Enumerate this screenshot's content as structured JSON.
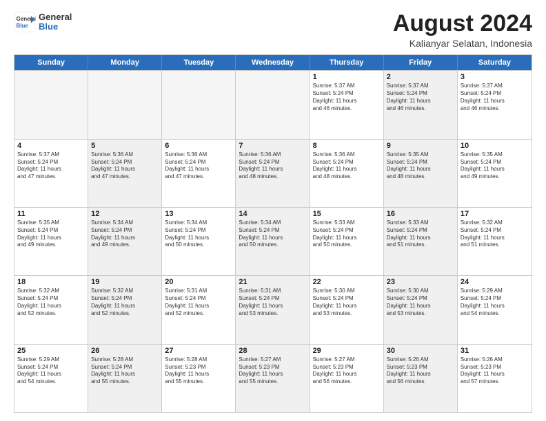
{
  "logo": {
    "line1": "General",
    "line2": "Blue"
  },
  "title": "August 2024",
  "subtitle": "Kalianyar Selatan, Indonesia",
  "headers": [
    "Sunday",
    "Monday",
    "Tuesday",
    "Wednesday",
    "Thursday",
    "Friday",
    "Saturday"
  ],
  "rows": [
    [
      {
        "day": "",
        "info": "",
        "empty": true
      },
      {
        "day": "",
        "info": "",
        "empty": true
      },
      {
        "day": "",
        "info": "",
        "empty": true
      },
      {
        "day": "",
        "info": "",
        "empty": true
      },
      {
        "day": "1",
        "info": "Sunrise: 5:37 AM\nSunset: 5:24 PM\nDaylight: 11 hours\nand 46 minutes.",
        "empty": false,
        "shaded": false
      },
      {
        "day": "2",
        "info": "Sunrise: 5:37 AM\nSunset: 5:24 PM\nDaylight: 11 hours\nand 46 minutes.",
        "empty": false,
        "shaded": true
      },
      {
        "day": "3",
        "info": "Sunrise: 5:37 AM\nSunset: 5:24 PM\nDaylight: 11 hours\nand 46 minutes.",
        "empty": false,
        "shaded": false
      }
    ],
    [
      {
        "day": "4",
        "info": "Sunrise: 5:37 AM\nSunset: 5:24 PM\nDaylight: 11 hours\nand 47 minutes.",
        "empty": false,
        "shaded": false
      },
      {
        "day": "5",
        "info": "Sunrise: 5:36 AM\nSunset: 5:24 PM\nDaylight: 11 hours\nand 47 minutes.",
        "empty": false,
        "shaded": true
      },
      {
        "day": "6",
        "info": "Sunrise: 5:36 AM\nSunset: 5:24 PM\nDaylight: 11 hours\nand 47 minutes.",
        "empty": false,
        "shaded": false
      },
      {
        "day": "7",
        "info": "Sunrise: 5:36 AM\nSunset: 5:24 PM\nDaylight: 11 hours\nand 48 minutes.",
        "empty": false,
        "shaded": true
      },
      {
        "day": "8",
        "info": "Sunrise: 5:36 AM\nSunset: 5:24 PM\nDaylight: 11 hours\nand 48 minutes.",
        "empty": false,
        "shaded": false
      },
      {
        "day": "9",
        "info": "Sunrise: 5:35 AM\nSunset: 5:24 PM\nDaylight: 11 hours\nand 48 minutes.",
        "empty": false,
        "shaded": true
      },
      {
        "day": "10",
        "info": "Sunrise: 5:35 AM\nSunset: 5:24 PM\nDaylight: 11 hours\nand 49 minutes.",
        "empty": false,
        "shaded": false
      }
    ],
    [
      {
        "day": "11",
        "info": "Sunrise: 5:35 AM\nSunset: 5:24 PM\nDaylight: 11 hours\nand 49 minutes.",
        "empty": false,
        "shaded": false
      },
      {
        "day": "12",
        "info": "Sunrise: 5:34 AM\nSunset: 5:24 PM\nDaylight: 11 hours\nand 49 minutes.",
        "empty": false,
        "shaded": true
      },
      {
        "day": "13",
        "info": "Sunrise: 5:34 AM\nSunset: 5:24 PM\nDaylight: 11 hours\nand 50 minutes.",
        "empty": false,
        "shaded": false
      },
      {
        "day": "14",
        "info": "Sunrise: 5:34 AM\nSunset: 5:24 PM\nDaylight: 11 hours\nand 50 minutes.",
        "empty": false,
        "shaded": true
      },
      {
        "day": "15",
        "info": "Sunrise: 5:33 AM\nSunset: 5:24 PM\nDaylight: 11 hours\nand 50 minutes.",
        "empty": false,
        "shaded": false
      },
      {
        "day": "16",
        "info": "Sunrise: 5:33 AM\nSunset: 5:24 PM\nDaylight: 11 hours\nand 51 minutes.",
        "empty": false,
        "shaded": true
      },
      {
        "day": "17",
        "info": "Sunrise: 5:32 AM\nSunset: 5:24 PM\nDaylight: 11 hours\nand 51 minutes.",
        "empty": false,
        "shaded": false
      }
    ],
    [
      {
        "day": "18",
        "info": "Sunrise: 5:32 AM\nSunset: 5:24 PM\nDaylight: 11 hours\nand 52 minutes.",
        "empty": false,
        "shaded": false
      },
      {
        "day": "19",
        "info": "Sunrise: 5:32 AM\nSunset: 5:24 PM\nDaylight: 11 hours\nand 52 minutes.",
        "empty": false,
        "shaded": true
      },
      {
        "day": "20",
        "info": "Sunrise: 5:31 AM\nSunset: 5:24 PM\nDaylight: 11 hours\nand 52 minutes.",
        "empty": false,
        "shaded": false
      },
      {
        "day": "21",
        "info": "Sunrise: 5:31 AM\nSunset: 5:24 PM\nDaylight: 11 hours\nand 53 minutes.",
        "empty": false,
        "shaded": true
      },
      {
        "day": "22",
        "info": "Sunrise: 5:30 AM\nSunset: 5:24 PM\nDaylight: 11 hours\nand 53 minutes.",
        "empty": false,
        "shaded": false
      },
      {
        "day": "23",
        "info": "Sunrise: 5:30 AM\nSunset: 5:24 PM\nDaylight: 11 hours\nand 53 minutes.",
        "empty": false,
        "shaded": true
      },
      {
        "day": "24",
        "info": "Sunrise: 5:29 AM\nSunset: 5:24 PM\nDaylight: 11 hours\nand 54 minutes.",
        "empty": false,
        "shaded": false
      }
    ],
    [
      {
        "day": "25",
        "info": "Sunrise: 5:29 AM\nSunset: 5:24 PM\nDaylight: 11 hours\nand 54 minutes.",
        "empty": false,
        "shaded": false
      },
      {
        "day": "26",
        "info": "Sunrise: 5:28 AM\nSunset: 5:24 PM\nDaylight: 11 hours\nand 55 minutes.",
        "empty": false,
        "shaded": true
      },
      {
        "day": "27",
        "info": "Sunrise: 5:28 AM\nSunset: 5:23 PM\nDaylight: 11 hours\nand 55 minutes.",
        "empty": false,
        "shaded": false
      },
      {
        "day": "28",
        "info": "Sunrise: 5:27 AM\nSunset: 5:23 PM\nDaylight: 11 hours\nand 55 minutes.",
        "empty": false,
        "shaded": true
      },
      {
        "day": "29",
        "info": "Sunrise: 5:27 AM\nSunset: 5:23 PM\nDaylight: 11 hours\nand 56 minutes.",
        "empty": false,
        "shaded": false
      },
      {
        "day": "30",
        "info": "Sunrise: 5:26 AM\nSunset: 5:23 PM\nDaylight: 11 hours\nand 56 minutes.",
        "empty": false,
        "shaded": true
      },
      {
        "day": "31",
        "info": "Sunrise: 5:26 AM\nSunset: 5:23 PM\nDaylight: 11 hours\nand 57 minutes.",
        "empty": false,
        "shaded": false
      }
    ]
  ]
}
